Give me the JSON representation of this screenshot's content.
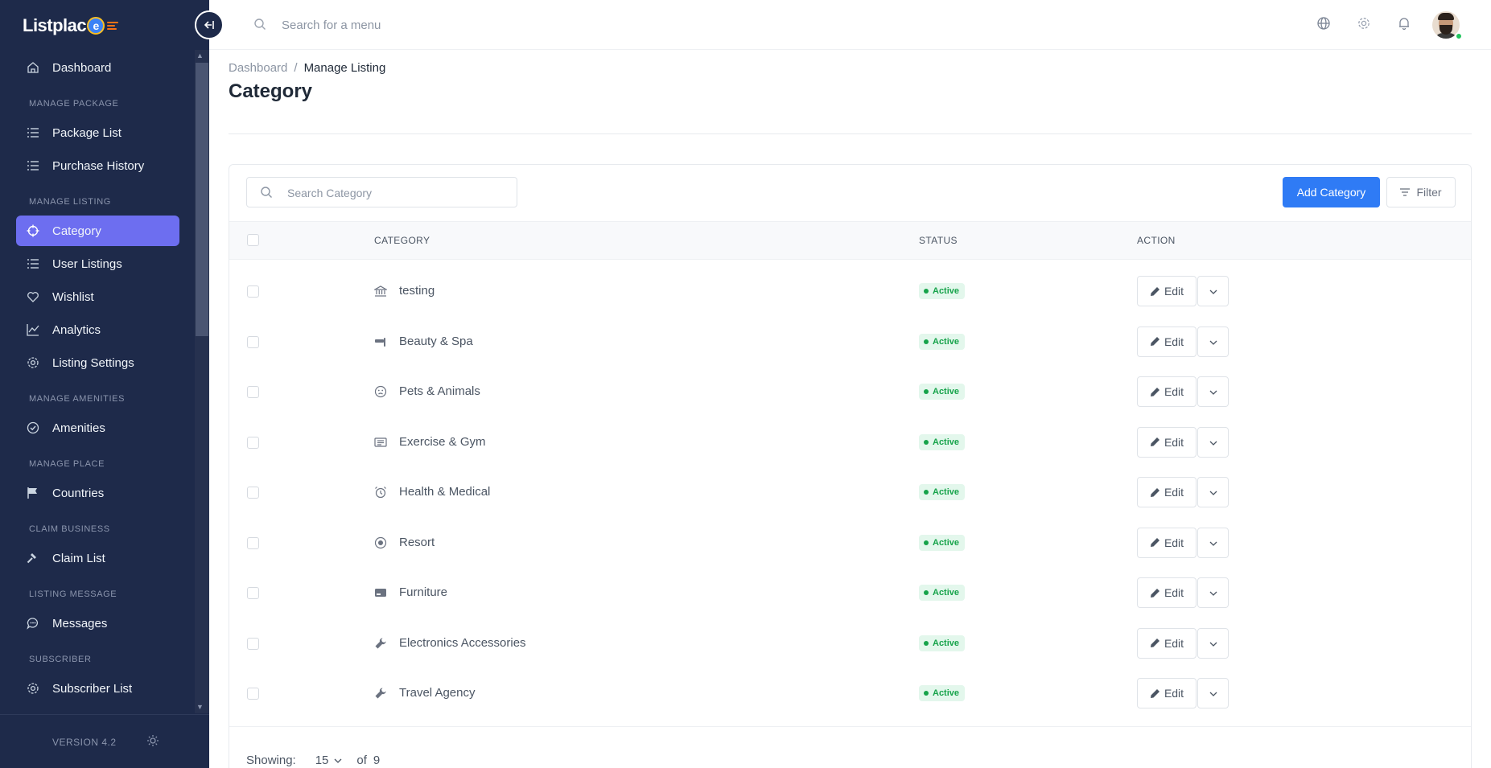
{
  "app": {
    "logo_text": "Listplac",
    "logo_badge": "e",
    "version": "VERSION 4.2"
  },
  "sidebar": {
    "items": [
      {
        "type": "item",
        "label": "Dashboard",
        "icon": "home-icon"
      },
      {
        "type": "section",
        "label": "MANAGE PACKAGE"
      },
      {
        "type": "item",
        "label": "Package List",
        "icon": "list-icon"
      },
      {
        "type": "item",
        "label": "Purchase History",
        "icon": "list-icon"
      },
      {
        "type": "section",
        "label": "MANAGE LISTING"
      },
      {
        "type": "item",
        "label": "Category",
        "icon": "crosshair-icon",
        "active": true
      },
      {
        "type": "item",
        "label": "User Listings",
        "icon": "list-icon"
      },
      {
        "type": "item",
        "label": "Wishlist",
        "icon": "heart-icon"
      },
      {
        "type": "item",
        "label": "Analytics",
        "icon": "chart-icon"
      },
      {
        "type": "item",
        "label": "Listing Settings",
        "icon": "gear-icon"
      },
      {
        "type": "section",
        "label": "MANAGE AMENITIES"
      },
      {
        "type": "item",
        "label": "Amenities",
        "icon": "check-circle-icon"
      },
      {
        "type": "section",
        "label": "MANAGE PLACE"
      },
      {
        "type": "item",
        "label": "Countries",
        "icon": "flag-icon"
      },
      {
        "type": "section",
        "label": "CLAIM BUSINESS"
      },
      {
        "type": "item",
        "label": "Claim List",
        "icon": "hammer-icon"
      },
      {
        "type": "section",
        "label": "LISTING MESSAGE"
      },
      {
        "type": "item",
        "label": "Messages",
        "icon": "chat-icon"
      },
      {
        "type": "section",
        "label": "SUBSCRIBER"
      },
      {
        "type": "item",
        "label": "Subscriber List",
        "icon": "gear-icon"
      }
    ]
  },
  "topbar": {
    "search_placeholder": "Search for a menu",
    "icons": [
      "globe-icon",
      "settings-icon",
      "bell-icon",
      "avatar"
    ]
  },
  "breadcrumb": {
    "root": "Dashboard",
    "separator": "/",
    "current": "Manage Listing"
  },
  "page": {
    "title": "Category"
  },
  "toolbar": {
    "search_placeholder": "Search Category",
    "add_label": "Add Category",
    "filter_label": "Filter"
  },
  "table": {
    "headers": {
      "category": "CATEGORY",
      "status": "STATUS",
      "action": "ACTION"
    },
    "rows": [
      {
        "name": "testing",
        "icon": "building-icon",
        "status": "Active",
        "edit": "Edit"
      },
      {
        "name": "Beauty & Spa",
        "icon": "hairdryer-icon",
        "status": "Active",
        "edit": "Edit"
      },
      {
        "name": "Pets & Animals",
        "icon": "face-icon",
        "status": "Active",
        "edit": "Edit"
      },
      {
        "name": "Exercise & Gym",
        "icon": "panel-icon",
        "status": "Active",
        "edit": "Edit"
      },
      {
        "name": "Health & Medical",
        "icon": "alarm-clock-icon",
        "status": "Active",
        "edit": "Edit"
      },
      {
        "name": "Resort",
        "icon": "radio-dot-icon",
        "status": "Active",
        "edit": "Edit"
      },
      {
        "name": "Furniture",
        "icon": "card-icon",
        "status": "Active",
        "edit": "Edit"
      },
      {
        "name": "Electronics Accessories",
        "icon": "wrench-icon",
        "status": "Active",
        "edit": "Edit"
      },
      {
        "name": "Travel Agency",
        "icon": "wrench-icon",
        "status": "Active",
        "edit": "Edit"
      }
    ]
  },
  "pagination": {
    "showing_label": "Showing:",
    "per_page": "15",
    "of_label": "of",
    "total": "9"
  },
  "colors": {
    "sidebar_bg": "#1e2a4a",
    "active_item": "#6d6ef0",
    "primary_button": "#2f7bf5",
    "status_active": "#16a34a"
  }
}
